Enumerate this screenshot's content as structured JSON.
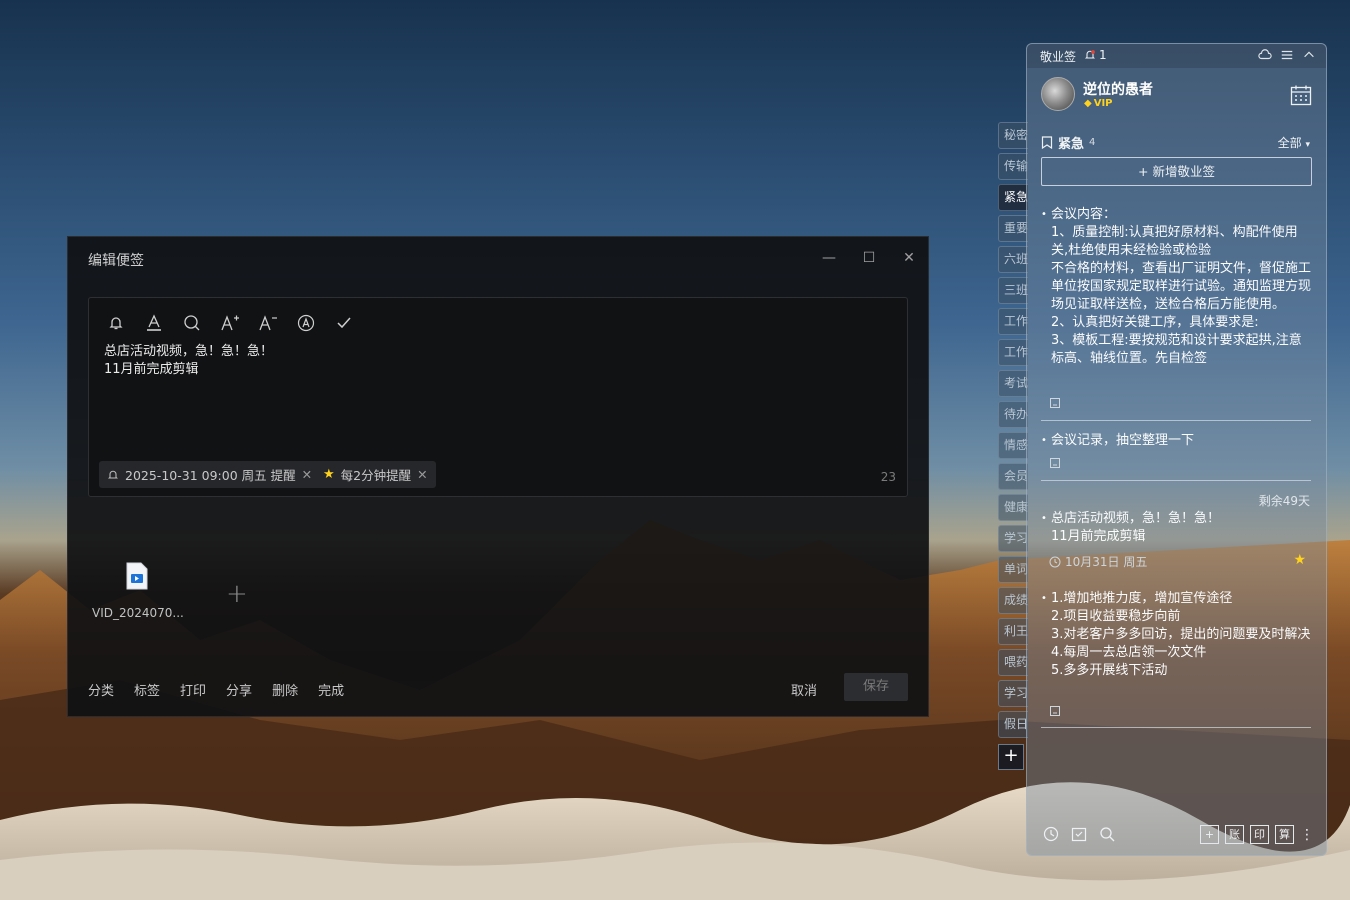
{
  "editor": {
    "title": "编辑便签",
    "note_lines": [
      "总店活动视频，急！急！急！",
      "11月前完成剪辑"
    ],
    "reminder_tag": "2025-10-31 09:00 周五 提醒",
    "repeat_tag": "每2分钟提醒",
    "char_count": "23",
    "attachment_name": "VID_2024070...",
    "actions": [
      "分类",
      "标签",
      "打印",
      "分享",
      "删除",
      "完成"
    ],
    "cancel_label": "取消",
    "save_label": "保存",
    "toolbar_icons": [
      "bell-icon",
      "font-color-icon",
      "search-icon",
      "font-increase-icon",
      "font-decrease-icon",
      "text-style-icon",
      "check-icon"
    ]
  },
  "side_tabs": [
    "秘密",
    "传输",
    "紧急",
    "重要",
    "六班",
    "三班",
    "工作",
    "工作",
    "考试",
    "待办",
    "情感",
    "会员",
    "健康",
    "学习",
    "单词",
    "成绩",
    "利王",
    "喂药",
    "学习",
    "假日"
  ],
  "side_tabs_active": "紧急",
  "panel": {
    "app_name": "敬业签",
    "bell_count": "1",
    "username": "逆位的愚者",
    "vip_label": "VIP",
    "category": "紧急",
    "category_count": "4",
    "filter_label": "全部",
    "new_button": "新增敬业签",
    "note1_lines": [
      "会议内容：",
      "1、质量控制:认真把好原材料、构配件使用关,杜绝使用未经检验或检验",
      "不合格的材料，查看出厂证明文件，督促施工单位按国家规定取样进行试验。通知监理方现场见证取样送检，送检合格后方能使用。",
      "2、认真把好关键工序，具体要求是:",
      "3、模板工程:要按规范和设计要求起拱,注意标高、轴线位置。先自检签"
    ],
    "note2_text": "会议记录，抽空整理一下",
    "remaining_label": "剩余49天",
    "note3_lines": [
      "总店活动视频，急！急！急！",
      "11月前完成剪辑"
    ],
    "note3_date": "10月31日 周五",
    "note4_lines": [
      "1.增加地推力度，增加宣传途径",
      "2.项目收益要稳步向前",
      "3.对老客户多多回访，提出的问题要及时解决",
      "4.每周一去总店领一次文件",
      "5.多多开展线下活动"
    ],
    "footer_boxes": [
      "账",
      "印",
      "算"
    ]
  },
  "colors": {
    "accent_gold": "#ffd21e",
    "editor_bg": "#101113"
  }
}
